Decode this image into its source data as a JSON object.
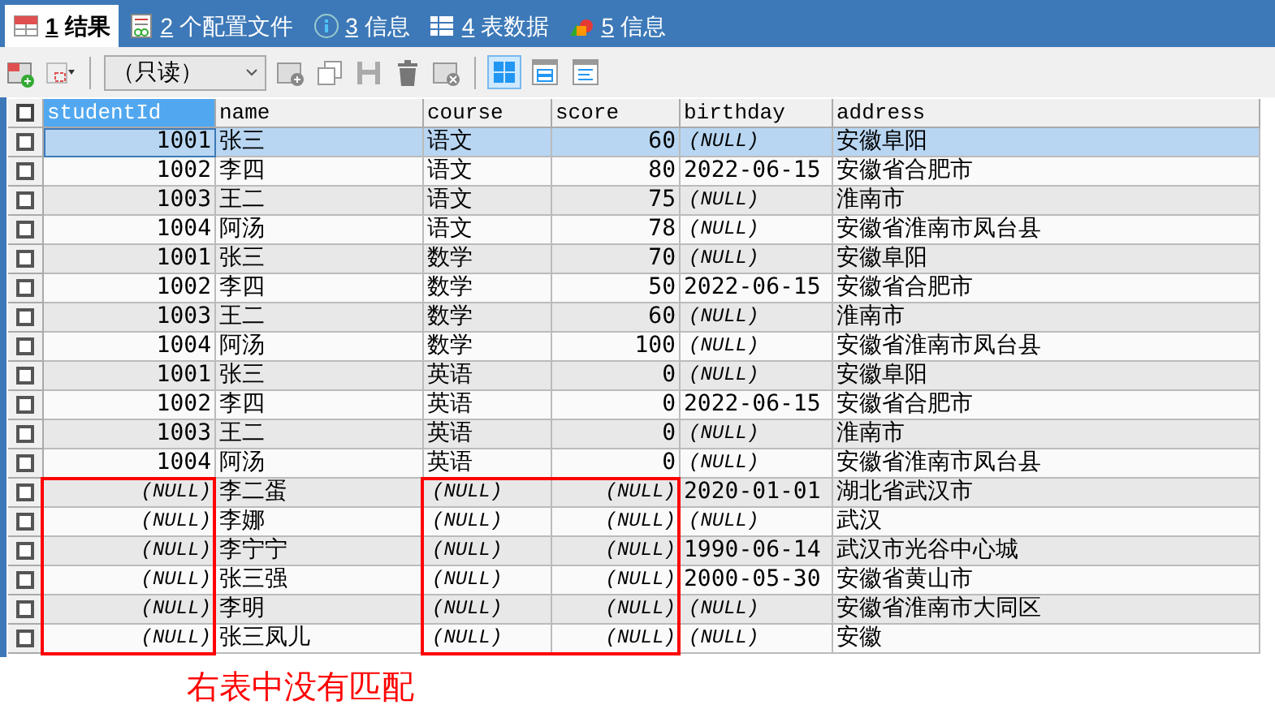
{
  "tabs": [
    {
      "number": "1",
      "label": "结果",
      "kind": "result",
      "selected": true
    },
    {
      "number": "2",
      "label": "个配置文件",
      "kind": "profile",
      "selected": false
    },
    {
      "number": "3",
      "label": "信息",
      "kind": "info",
      "selected": false
    },
    {
      "number": "4",
      "label": "表数据",
      "kind": "table",
      "selected": false
    },
    {
      "number": "5",
      "label": "信息",
      "kind": "shapes",
      "selected": false
    }
  ],
  "toolbar": {
    "mode": "（只读）",
    "views": [
      {
        "kind": "grid",
        "selected": true
      },
      {
        "kind": "form",
        "selected": false
      },
      {
        "kind": "text",
        "selected": false
      }
    ]
  },
  "table": {
    "columns": [
      {
        "label": "studentId",
        "selected": true
      },
      {
        "label": "name",
        "selected": false
      },
      {
        "label": "course",
        "selected": false
      },
      {
        "label": "score",
        "selected": false
      },
      {
        "label": "birthday",
        "selected": false
      },
      {
        "label": "address",
        "selected": false
      }
    ],
    "rows": [
      {
        "selected": true,
        "checked": false,
        "cells": [
          "1001",
          "张三",
          "语文",
          "60",
          {
            "text": "(NULL)",
            "null": true
          },
          "安徽阜阳"
        ]
      },
      {
        "selected": false,
        "checked": false,
        "cells": [
          "1002",
          "李四",
          "语文",
          "80",
          "2022-06-15",
          "安徽省合肥市"
        ]
      },
      {
        "selected": false,
        "checked": false,
        "cells": [
          "1003",
          "王二",
          "语文",
          "75",
          {
            "text": "(NULL)",
            "null": true
          },
          "淮南市"
        ]
      },
      {
        "selected": false,
        "checked": false,
        "cells": [
          "1004",
          "阿汤",
          "语文",
          "78",
          {
            "text": "(NULL)",
            "null": true
          },
          "安徽省淮南市凤台县"
        ]
      },
      {
        "selected": false,
        "checked": false,
        "cells": [
          "1001",
          "张三",
          "数学",
          "70",
          {
            "text": "(NULL)",
            "null": true
          },
          "安徽阜阳"
        ]
      },
      {
        "selected": false,
        "checked": false,
        "cells": [
          "1002",
          "李四",
          "数学",
          "50",
          "2022-06-15",
          "安徽省合肥市"
        ]
      },
      {
        "selected": false,
        "checked": false,
        "cells": [
          "1003",
          "王二",
          "数学",
          "60",
          {
            "text": "(NULL)",
            "null": true
          },
          "淮南市"
        ]
      },
      {
        "selected": false,
        "checked": false,
        "cells": [
          "1004",
          "阿汤",
          "数学",
          "100",
          {
            "text": "(NULL)",
            "null": true
          },
          "安徽省淮南市凤台县"
        ]
      },
      {
        "selected": false,
        "checked": false,
        "cells": [
          "1001",
          "张三",
          "英语",
          "0",
          {
            "text": "(NULL)",
            "null": true
          },
          "安徽阜阳"
        ]
      },
      {
        "selected": false,
        "checked": false,
        "cells": [
          "1002",
          "李四",
          "英语",
          "0",
          "2022-06-15",
          "安徽省合肥市"
        ]
      },
      {
        "selected": false,
        "checked": false,
        "cells": [
          "1003",
          "王二",
          "英语",
          "0",
          {
            "text": "(NULL)",
            "null": true
          },
          "淮南市"
        ]
      },
      {
        "selected": false,
        "checked": false,
        "cells": [
          "1004",
          "阿汤",
          "英语",
          "0",
          {
            "text": "(NULL)",
            "null": true
          },
          "安徽省淮南市凤台县"
        ]
      },
      {
        "selected": false,
        "checked": false,
        "cells": [
          {
            "text": "(NULL)",
            "null": true
          },
          "李二蛋",
          {
            "text": "(NULL)",
            "null": true
          },
          {
            "text": "(NULL)",
            "null": true
          },
          "2020-01-01",
          "湖北省武汉市"
        ]
      },
      {
        "selected": false,
        "checked": false,
        "cells": [
          {
            "text": "(NULL)",
            "null": true
          },
          "李娜",
          {
            "text": "(NULL)",
            "null": true
          },
          {
            "text": "(NULL)",
            "null": true
          },
          {
            "text": "(NULL)",
            "null": true
          },
          "武汉"
        ]
      },
      {
        "selected": false,
        "checked": false,
        "cells": [
          {
            "text": "(NULL)",
            "null": true
          },
          "李宁宁",
          {
            "text": "(NULL)",
            "null": true
          },
          {
            "text": "(NULL)",
            "null": true
          },
          "1990-06-14",
          "武汉市光谷中心城"
        ]
      },
      {
        "selected": false,
        "checked": false,
        "cells": [
          {
            "text": "(NULL)",
            "null": true
          },
          "张三强",
          {
            "text": "(NULL)",
            "null": true
          },
          {
            "text": "(NULL)",
            "null": true
          },
          "2000-05-30",
          "安徽省黄山市"
        ]
      },
      {
        "selected": false,
        "checked": false,
        "cells": [
          {
            "text": "(NULL)",
            "null": true
          },
          "李明",
          {
            "text": "(NULL)",
            "null": true
          },
          {
            "text": "(NULL)",
            "null": true
          },
          {
            "text": "(NULL)",
            "null": true
          },
          "安徽省淮南市大同区"
        ]
      },
      {
        "selected": false,
        "checked": false,
        "cells": [
          {
            "text": "(NULL)",
            "null": true
          },
          "张三凤儿",
          {
            "text": "(NULL)",
            "null": true
          },
          {
            "text": "(NULL)",
            "null": true
          },
          {
            "text": "(NULL)",
            "null": true
          },
          "安徽"
        ]
      }
    ],
    "all_checked": false
  },
  "annotation": "右表中没有匹配"
}
